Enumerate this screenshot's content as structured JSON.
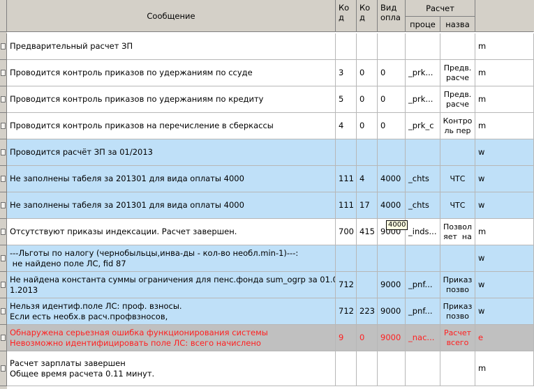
{
  "columns": {
    "message": "Сообщение",
    "code1": "Ко\nд",
    "code2": "Ко\nд",
    "pay_type": "Вид\nопла",
    "calc_group": "Расчет",
    "proc": "проце",
    "name": "назва"
  },
  "tooltip": "4000",
  "rows": [
    {
      "style": "white",
      "message": "Предварительный расчет ЗП",
      "code1": "",
      "code2": "",
      "pay_type": "",
      "proc": "",
      "name": "",
      "flag": "m"
    },
    {
      "style": "white",
      "message": "Проводится контроль приказов по удержаниям по ссуде",
      "code1": "3",
      "code2": "0",
      "pay_type": "0",
      "proc": "_prk...",
      "name": "Предв.\nрасче",
      "flag": "m"
    },
    {
      "style": "white",
      "message": "Проводится контроль приказов по удержаниям по кредиту",
      "code1": "5",
      "code2": "0",
      "pay_type": "0",
      "proc": "_prk...",
      "name": "Предв.\nрасче",
      "flag": "m"
    },
    {
      "style": "white",
      "message": "Проводится контроль приказов на перечисление в сберкассы",
      "code1": "4",
      "code2": "0",
      "pay_type": "0",
      "proc": "_prk_c",
      "name": "Контро\nль пер",
      "flag": "m"
    },
    {
      "style": "blue",
      "message": "Проводится расчёт ЗП за 01/2013",
      "code1": "",
      "code2": "",
      "pay_type": "",
      "proc": "",
      "name": "",
      "flag": "w"
    },
    {
      "style": "blue",
      "message": "Не заполнены табеля за 201301 для вида оплаты 4000",
      "code1": "111",
      "code2": "4",
      "pay_type": "4000",
      "proc": "_chts",
      "name": "ЧТС",
      "flag": "w"
    },
    {
      "style": "blue",
      "message": "Не заполнены табеля за 201301 для вида оплаты 4000",
      "code1": "111",
      "code2": "17",
      "pay_type": "4000",
      "proc": "_chts",
      "name": "ЧТС",
      "flag": "w"
    },
    {
      "style": "white",
      "message": "Отсутствуют приказы индексации. Расчет завершен.",
      "code1": "700",
      "code2": "415",
      "pay_type": "9000",
      "proc": "_inds...",
      "name": "Позвол\nяет  на",
      "flag": "m"
    },
    {
      "style": "blue",
      "message": "---Льготы по налогу (чернобыльцы,инва-ды - кол-во необл.min-1)---:\n не найдено поле ЛС, fid 87",
      "code1": "",
      "code2": "",
      "pay_type": "",
      "proc": "",
      "name": "",
      "flag": "w"
    },
    {
      "style": "blue",
      "message": "Не найдена константа суммы ограничения для пенс.фонда sum_ogrp за 01.0\n1.2013",
      "code1": "712",
      "code2": "",
      "pay_type": "9000",
      "proc": "_pnf...",
      "name": "Приказ\nпозво",
      "flag": "w"
    },
    {
      "style": "blue",
      "message": "Нельзя идентиф.поле ЛС: проф. взносы.\nЕсли есть необх.в расч.профвзносов,",
      "code1": "712",
      "code2": "223",
      "pay_type": "9000",
      "proc": "_pnf...",
      "name": "Приказ\nпозво",
      "flag": "w"
    },
    {
      "style": "gray",
      "message": "Обнаружена серьезная ошибка функционирования системы\nНевозможно идентифицировать поле ЛС: всего начислено",
      "code1": "9",
      "code2": "0",
      "pay_type": "9000",
      "proc": "_nac...",
      "name": "Расчет\nвсего",
      "flag": "e"
    },
    {
      "style": "white",
      "message": "Расчет зарплаты завершен\nОбщее время расчета 0.11 минут.",
      "code1": "",
      "code2": "",
      "pay_type": "",
      "proc": "",
      "name": "",
      "flag": "m"
    }
  ]
}
